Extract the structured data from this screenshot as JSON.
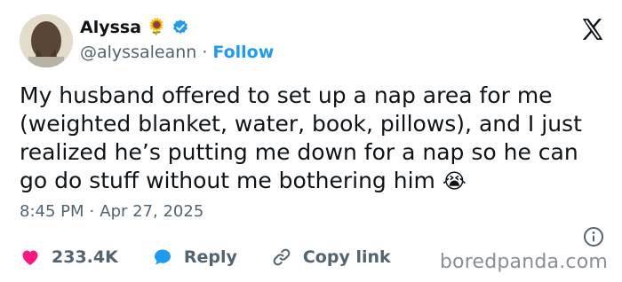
{
  "user": {
    "display_name": "Alyssa",
    "name_emoji": "🌻",
    "handle": "@alyssaleann",
    "separator": "·",
    "follow_label": "Follow"
  },
  "tweet": {
    "text": "My husband offered to set up a nap area for me (weighted blanket, water, book, pillows), and I just realized he’s putting me down for a nap so he can go do stuff without me bothering him",
    "emoji": "😭",
    "time": "8:45 PM",
    "separator": "·",
    "date": "Apr 27, 2025"
  },
  "actions": {
    "likes": "233.4K",
    "reply_label": "Reply",
    "copy_label": "Copy link"
  },
  "watermark": "boredpanda.com",
  "colors": {
    "accent": "#1d9bf0",
    "like": "#f91880",
    "text": "#0f1419",
    "muted": "#536471"
  },
  "icons": [
    "verified-badge-icon",
    "x-logo-icon",
    "info-icon",
    "heart-icon",
    "reply-bubble-icon",
    "link-icon"
  ]
}
